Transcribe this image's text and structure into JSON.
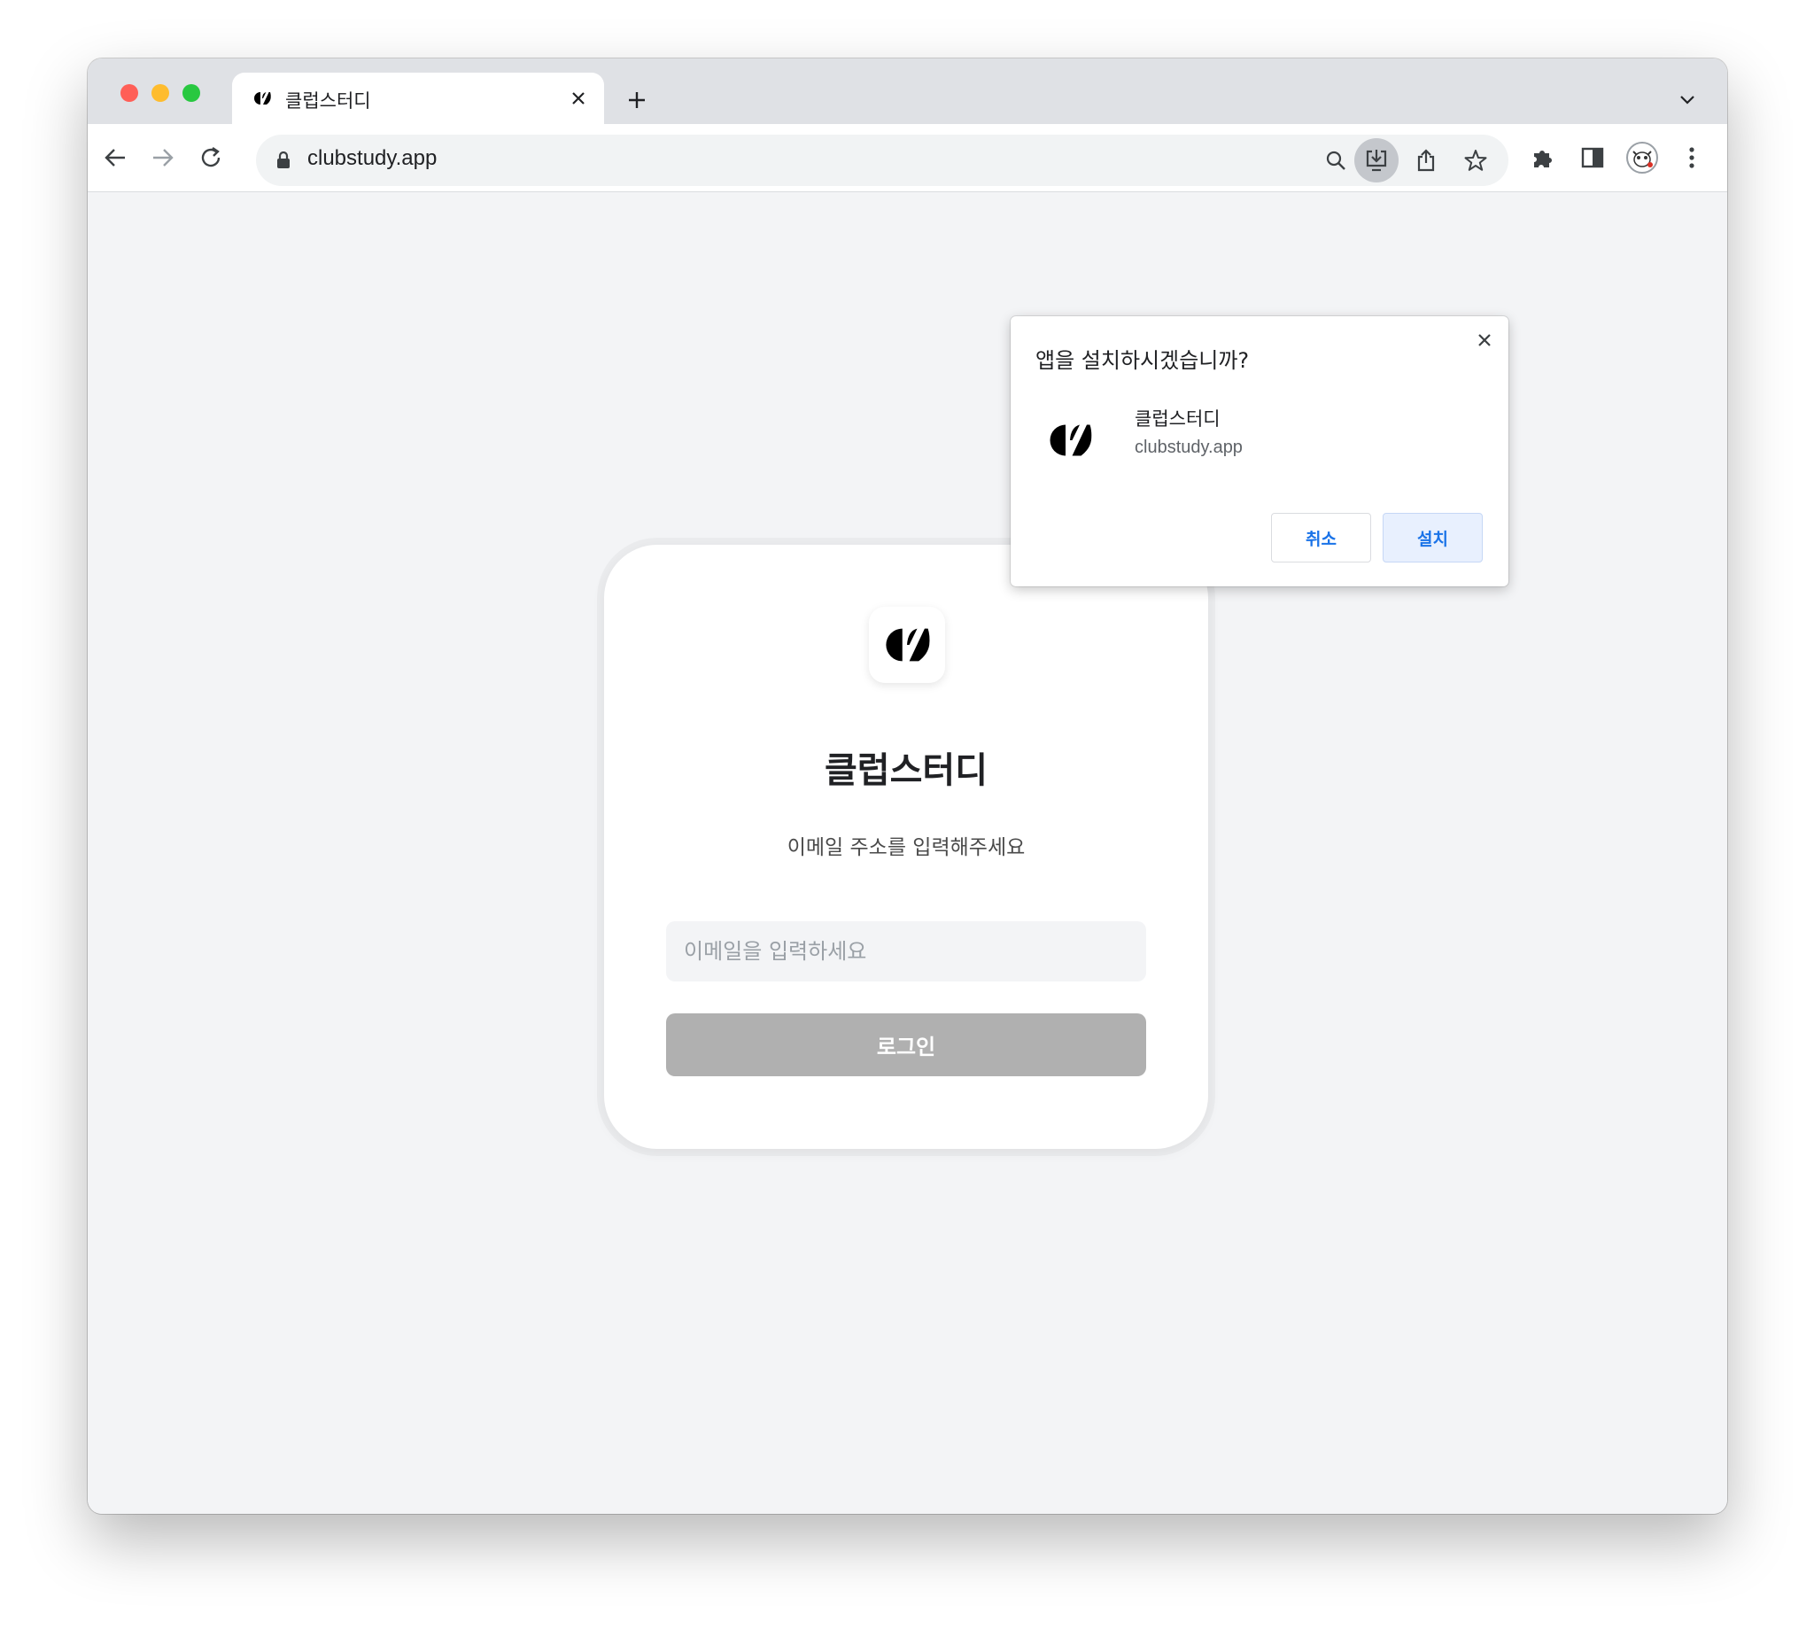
{
  "browser": {
    "tab_title": "클럽스터디",
    "url": "clubstudy.app"
  },
  "icons": {
    "back": "arrow-left-icon",
    "forward": "arrow-right-icon",
    "reload": "reload-icon",
    "lock": "lock-icon",
    "search": "search-icon",
    "install": "install-app-icon",
    "share": "share-icon",
    "bookmark": "star-icon",
    "extensions": "puzzle-icon",
    "side_panel": "side-panel-icon",
    "menu": "kebab-menu-icon"
  },
  "install_prompt": {
    "title": "앱을 설치하시겠습니까?",
    "app_name": "클럽스터디",
    "app_url": "clubstudy.app",
    "cancel_label": "취소",
    "install_label": "설치"
  },
  "login": {
    "app_name": "클럽스터디",
    "subtitle": "이메일 주소를 입력해주세요",
    "email_value": "",
    "email_placeholder": "이메일을 입력하세요",
    "login_label": "로그인"
  },
  "colors": {
    "accent": "#1a73e8",
    "login_button_disabled": "#b0b0b0",
    "page_background": "#f3f4f6"
  }
}
